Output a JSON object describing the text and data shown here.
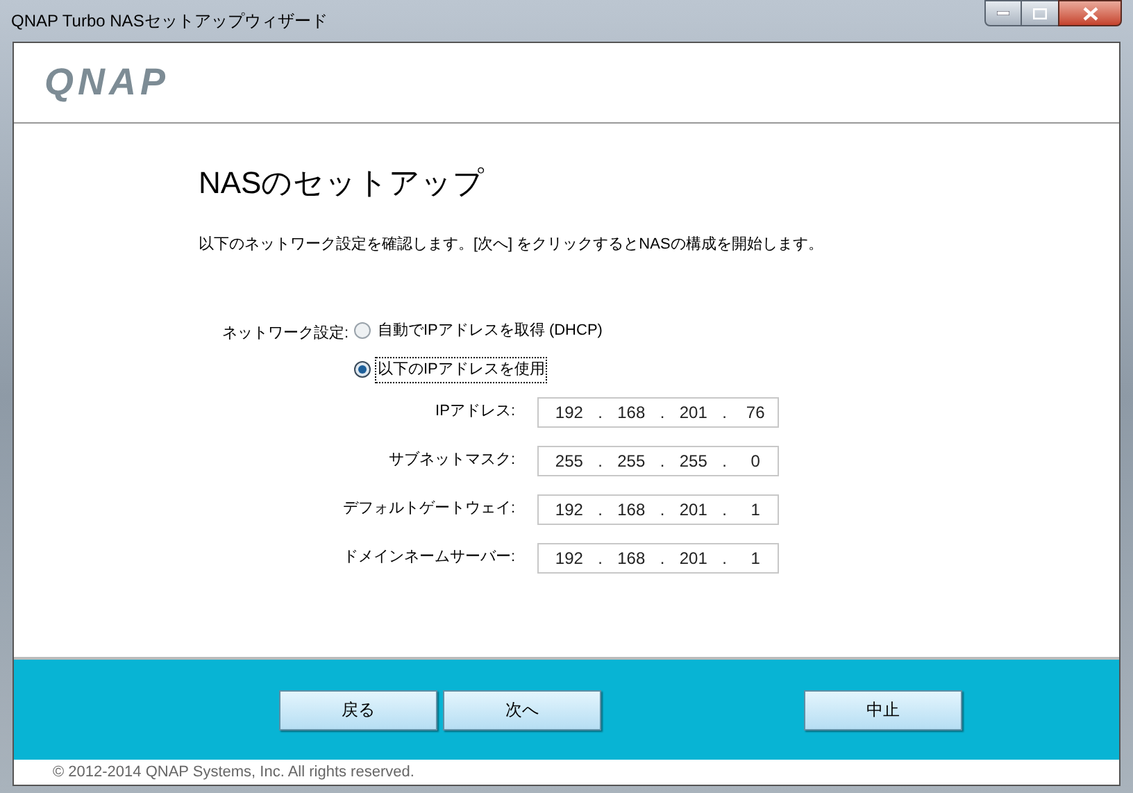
{
  "window": {
    "title": "QNAP Turbo NASセットアップウィザード"
  },
  "logo": "QNAP",
  "heading": "NASのセットアップ",
  "description": "以下のネットワーク設定を確認します。[次へ] をクリックするとNASの構成を開始します。",
  "network": {
    "label": "ネットワーク設定:",
    "options": [
      {
        "label": "自動でIPアドレスを取得 (DHCP)",
        "selected": false
      },
      {
        "label": "以下のIPアドレスを使用",
        "selected": true
      }
    ]
  },
  "fields": [
    {
      "label": "IPアドレス:",
      "parts": [
        "192",
        ".",
        "168",
        ".",
        "201",
        ".",
        "76"
      ]
    },
    {
      "label": "サブネットマスク:",
      "parts": [
        "255",
        ".",
        "255",
        ".",
        "255",
        ".",
        "0"
      ]
    },
    {
      "label": "デフォルトゲートウェイ:",
      "parts": [
        "192",
        ".",
        "168",
        ".",
        "201",
        ".",
        "1"
      ]
    },
    {
      "label": "ドメインネームサーバー:",
      "parts": [
        "192",
        ".",
        "168",
        ".",
        "201",
        ".",
        "1"
      ]
    }
  ],
  "buttons": [
    {
      "label": "戻る"
    },
    {
      "label": "次へ"
    },
    {
      "label": "中止"
    }
  ],
  "footer": "© 2012-2014 QNAP Systems, Inc. All rights reserved."
}
